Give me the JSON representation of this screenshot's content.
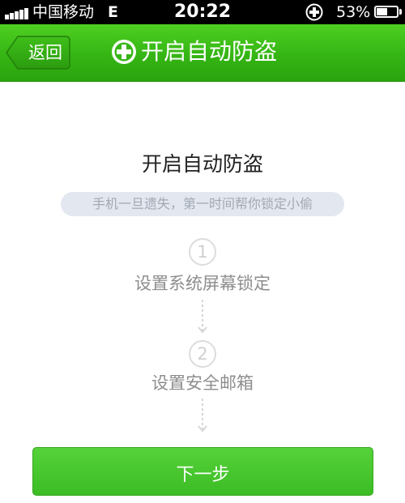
{
  "status_bar": {
    "carrier": "中国移动",
    "network": "E",
    "time": "20:22",
    "battery_percent": "53%",
    "battery_level": 0.53,
    "signal_bars": 5
  },
  "nav": {
    "back_label": "返回",
    "title": "开启自动防盗"
  },
  "main": {
    "heading": "开启自动防盗",
    "subtitle": "手机一旦遗失，第一时间帮你锁定小偷",
    "steps": [
      {
        "number": "1",
        "label": "设置系统屏幕锁定"
      },
      {
        "number": "2",
        "label": "设置安全邮箱"
      }
    ],
    "next_button": "下一步"
  },
  "colors": {
    "brand_green": "#35b514",
    "button_green": "#4bc832"
  }
}
